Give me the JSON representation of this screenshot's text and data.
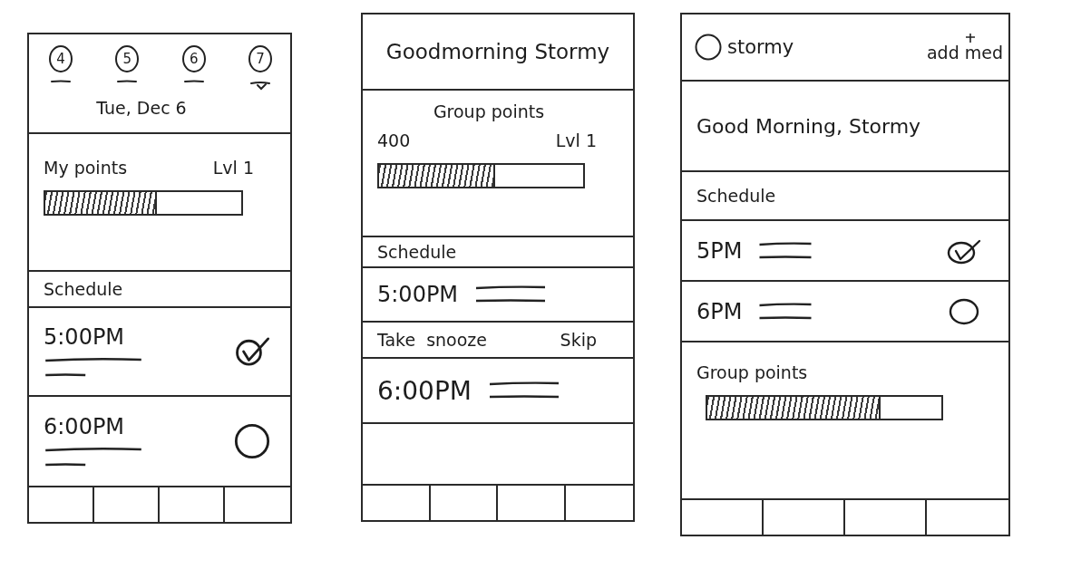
{
  "screens": [
    {
      "sections": [
        {
          "kind": "day_picker",
          "days": [
            {
              "label": "4",
              "selected": false
            },
            {
              "label": "5",
              "selected": false
            },
            {
              "label": "6",
              "selected": false
            },
            {
              "label": "7",
              "selected": true
            }
          ],
          "date": "Tue, Dec 6"
        },
        {
          "kind": "points",
          "title": "My points",
          "level_label": "Lvl 1",
          "level": 0.57
        },
        {
          "kind": "heading",
          "text": "Schedule"
        },
        {
          "kind": "dose_card",
          "time": "5:00PM",
          "checked": true
        },
        {
          "kind": "dose_card",
          "time": "6:00PM",
          "checked": false
        },
        {
          "kind": "tab_bar"
        }
      ]
    },
    {
      "sections": [
        {
          "kind": "greeting",
          "text": "Goodmorning Stormy"
        },
        {
          "kind": "points",
          "title": "Group points",
          "value": "400",
          "level_label": "Lvl 1",
          "level": 0.57
        },
        {
          "kind": "heading",
          "text": "Schedule"
        },
        {
          "kind": "dose_row",
          "time": "5:00PM",
          "actions": [
            "Take",
            "snooze",
            "Skip"
          ]
        },
        {
          "kind": "dose_row",
          "time": "6:00PM"
        },
        {
          "kind": "tab_bar"
        }
      ]
    },
    {
      "sections": [
        {
          "kind": "profile_bar",
          "name": "stormy",
          "button": "add med"
        },
        {
          "kind": "greeting",
          "text": "Good Morning, Stormy"
        },
        {
          "kind": "heading",
          "text": "Schedule"
        },
        {
          "kind": "dose_row",
          "time": "5PM",
          "checked": true
        },
        {
          "kind": "dose_row",
          "time": "6PM",
          "checked": false
        },
        {
          "kind": "points",
          "title": "Group points",
          "level": 0.74
        },
        {
          "kind": "tab_bar"
        }
      ]
    }
  ]
}
